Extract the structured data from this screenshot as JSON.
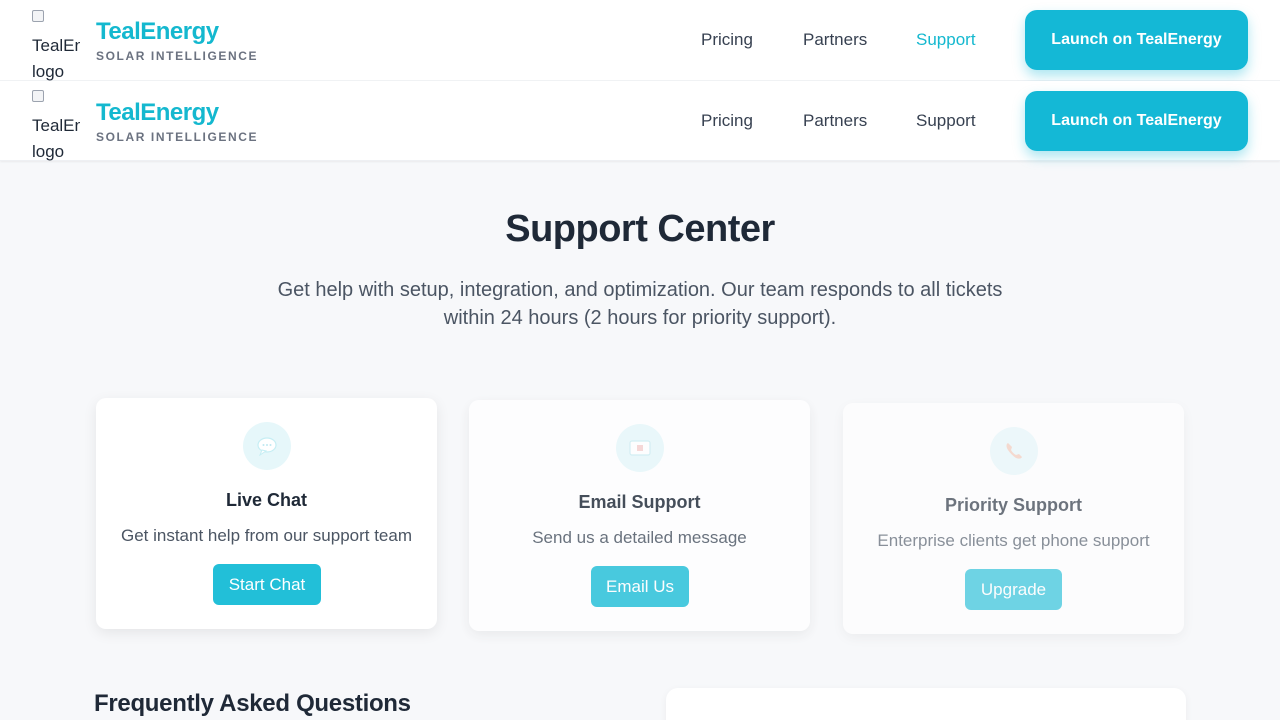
{
  "brand": {
    "name": "TealEnergy",
    "tagline": "SOLAR INTELLIGENCE",
    "logo_alt": "TealEnergy logo",
    "accent_color": "#14b8cf"
  },
  "header_primary": {
    "nav": [
      "Pricing",
      "Partners",
      "Support"
    ],
    "active": "Support",
    "cta_label": "Launch on TealEnergy"
  },
  "header_secondary": {
    "nav": [
      "Pricing",
      "Partners",
      "Support"
    ],
    "cta_label": "Launch on TealEnergy"
  },
  "hero": {
    "title": "Support Center",
    "subtitle": "Get help with setup, integration, and optimization. Our team responds to all tickets within 24 hours (2 hours for priority support)."
  },
  "cards": [
    {
      "icon": "chat-bubble-icon",
      "title": "Live Chat",
      "description": "Get instant help from our support team",
      "button": "Start Chat"
    },
    {
      "icon": "envelope-icon",
      "title": "Email Support",
      "description": "Send us a detailed message",
      "button": "Email Us"
    },
    {
      "icon": "phone-icon",
      "title": "Priority Support",
      "description": "Enterprise clients get phone support",
      "button": "Upgrade"
    }
  ],
  "faq": {
    "title": "Frequently Asked Questions"
  }
}
